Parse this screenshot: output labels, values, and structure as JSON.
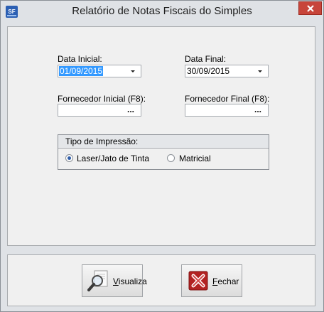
{
  "window": {
    "title": "Relatório de Notas Fiscais do Simples",
    "app_icon_text": "SF"
  },
  "fields": {
    "data_inicial": {
      "label": "Data Inicial:",
      "value": "01/09/2015"
    },
    "data_final": {
      "label": "Data Final:",
      "value": "30/09/2015"
    },
    "fornecedor_inicial": {
      "label": "Fornecedor Inicial (F8):",
      "value": "",
      "button": "..."
    },
    "fornecedor_final": {
      "label": "Fornecedor Final (F8):",
      "value": "",
      "button": "..."
    }
  },
  "print_type": {
    "title": "Tipo de Impressão:",
    "options": [
      {
        "label": "Laser/Jato de Tinta",
        "selected": true
      },
      {
        "label": "Matricial",
        "selected": false
      }
    ]
  },
  "buttons": {
    "visualiza": {
      "accel": "V",
      "rest": "isualiza"
    },
    "fechar": {
      "accel": "F",
      "rest": "echar"
    }
  }
}
